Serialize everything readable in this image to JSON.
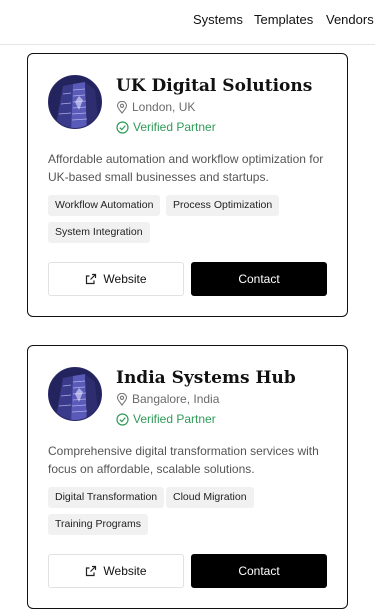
{
  "nav": {
    "items": [
      {
        "label": "Systems"
      },
      {
        "label": "Templates"
      },
      {
        "label": "Vendors"
      }
    ]
  },
  "cards": [
    {
      "name": "UK Digital Solutions",
      "location": "London, UK",
      "verified": "Verified Partner",
      "description": "Affordable automation and workflow optimization for UK-based small businesses and startups.",
      "tags": [
        "Workflow Automation",
        "Process Optimization",
        "System Integration"
      ],
      "website_label": "Website",
      "contact_label": "Contact"
    },
    {
      "name": "India Systems Hub",
      "location": "Bangalore, India",
      "verified": "Verified Partner",
      "description": "Comprehensive digital transformation services with focus on affordable, scalable solutions.",
      "tags": [
        "Digital Transformation",
        "Cloud Migration",
        "Training Programs"
      ],
      "website_label": "Website",
      "contact_label": "Contact"
    }
  ],
  "colors": {
    "verified": "#2e9b57",
    "contact_bg": "#000000",
    "tag_bg": "#f1f1f1",
    "border": "#111111"
  },
  "icons": {
    "location": "map-pin-icon",
    "verified": "check-circle-icon",
    "website": "external-link-icon"
  }
}
